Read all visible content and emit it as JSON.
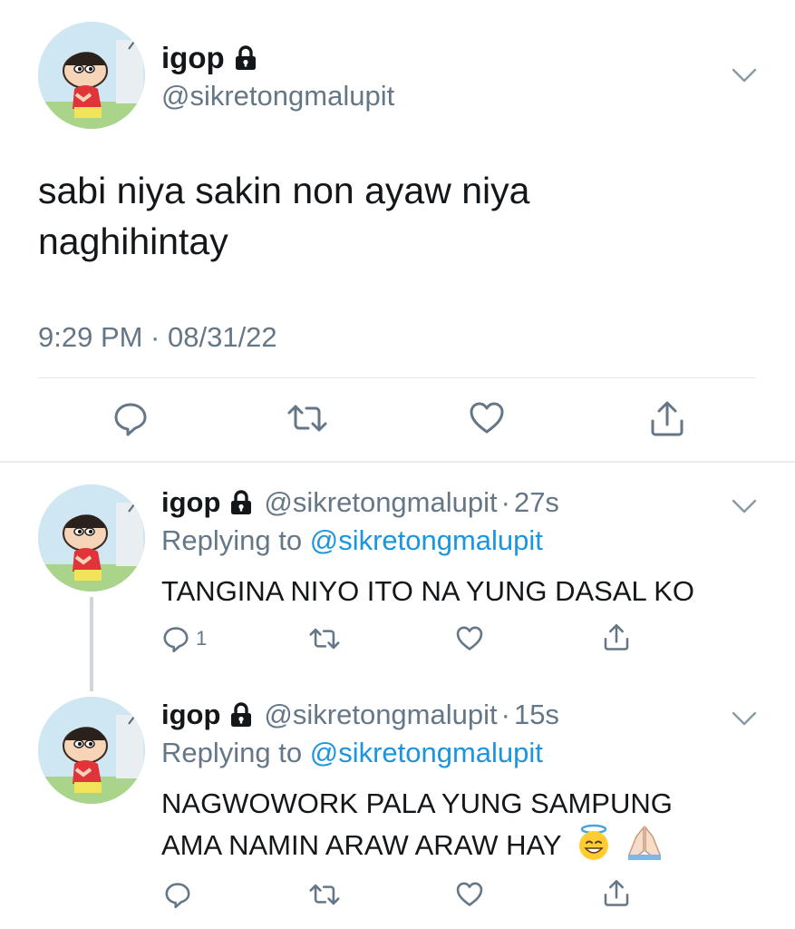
{
  "main_tweet": {
    "user_name": "igop",
    "handle": "@sikretongmalupit",
    "text_line1": "sabi niya sakin non ayaw niya",
    "text_line2": "naghihintay",
    "timestamp": "9:29 PM · 08/31/22",
    "icons": [
      "lock-icon",
      "chevron-down-icon",
      "reply-icon",
      "retweet-icon",
      "like-icon",
      "share-icon"
    ]
  },
  "replies": [
    {
      "user_name": "igop",
      "handle": "@sikretongmalupit",
      "separator": "·",
      "time": "27s",
      "replying_label": "Replying to",
      "replying_to": "@sikretongmalupit",
      "text_line1": "TANGINA NIYO ITO NA YUNG DASAL KO",
      "reply_count": "1"
    },
    {
      "user_name": "igop",
      "handle": "@sikretongmalupit",
      "separator": "·",
      "time": "15s",
      "replying_label": "Replying to",
      "replying_to": "@sikretongmalupit",
      "text_line1": "NAGWOWORK PALA YUNG SAMPUNG",
      "text_line2": "AMA NAMIN ARAW ARAW HAY",
      "emojis": [
        "smiling-face-with-halo",
        "folded-hands"
      ]
    }
  ],
  "colors": {
    "text": "#14171a",
    "secondary": "#657786",
    "link": "#1b95e0",
    "divider": "#e1e8ed"
  }
}
